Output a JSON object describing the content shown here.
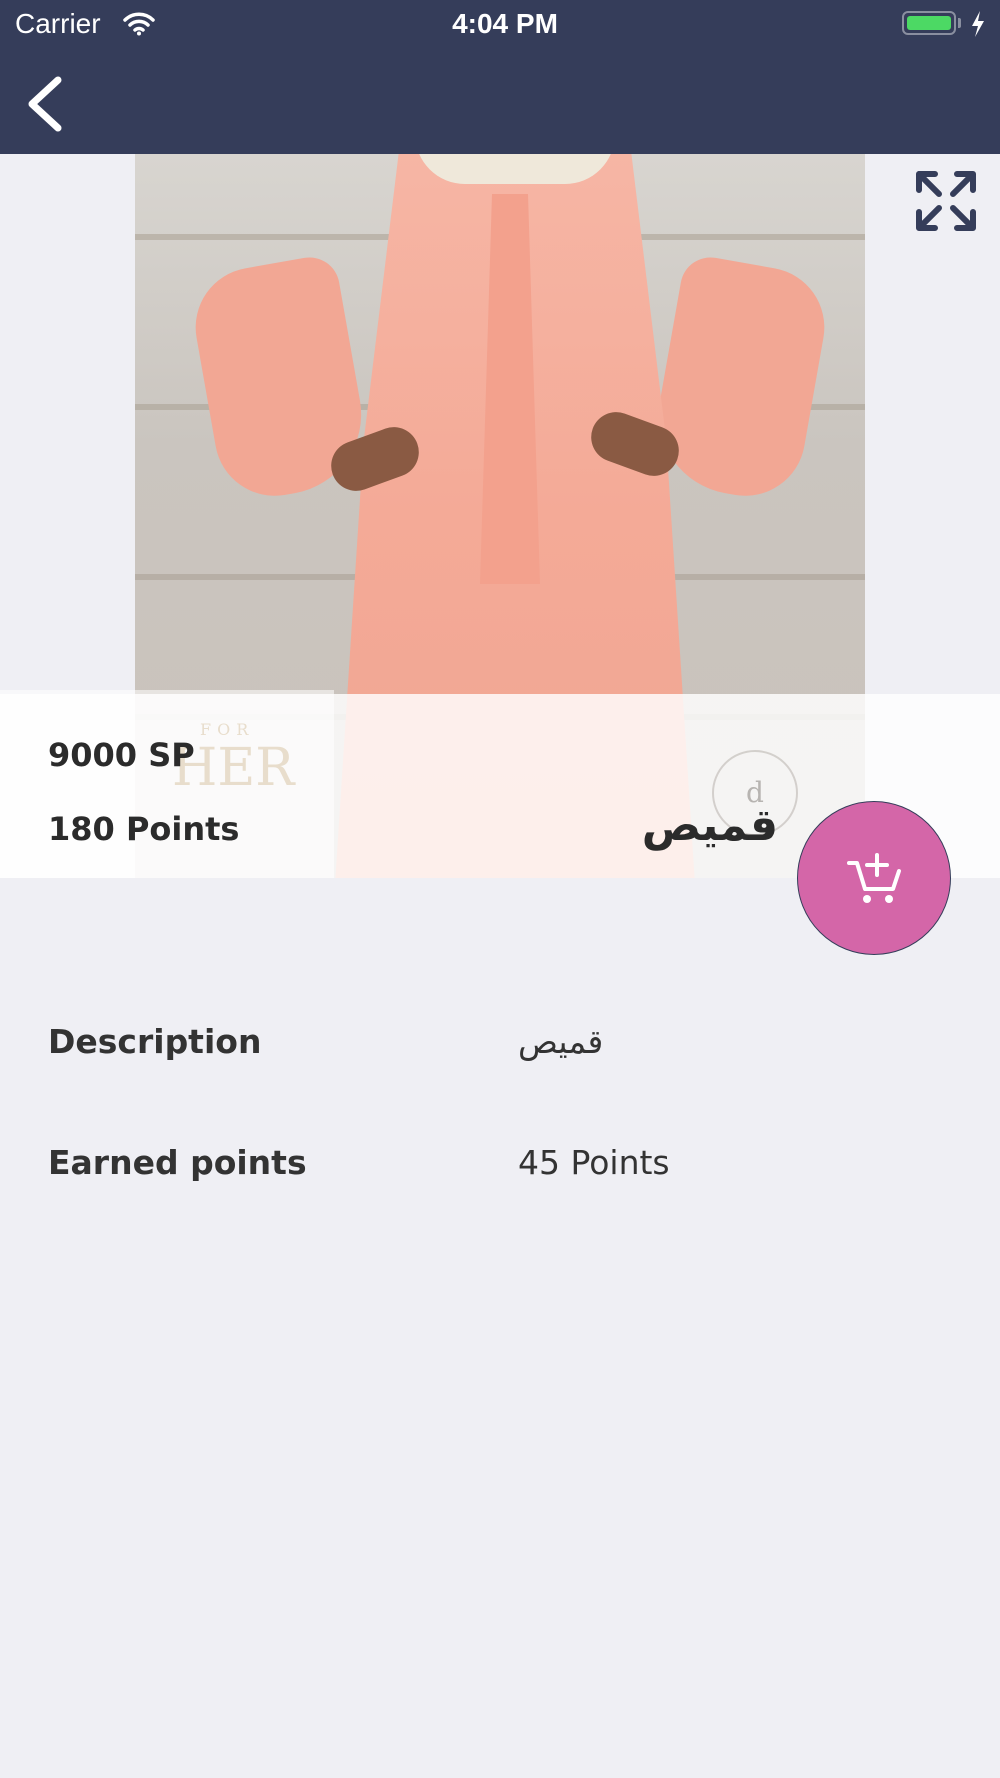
{
  "status_bar": {
    "carrier": "Carrier",
    "time": "4:04 PM"
  },
  "nav": {
    "back_icon": "chevron-left-icon"
  },
  "image": {
    "fullscreen_icon": "expand-arrows-icon",
    "logo_sub": "FOR",
    "logo_main": "HER",
    "seal_text": "d"
  },
  "product": {
    "price": "9000 SP",
    "points": "180 Points",
    "name": "قميص"
  },
  "cart_button": {
    "icon": "add-to-cart-icon",
    "color": "#d466a8"
  },
  "details": [
    {
      "label": "Description",
      "value": "قميص"
    },
    {
      "label": "Earned points",
      "value": "45 Points"
    }
  ],
  "colors": {
    "header": "#353d5a",
    "background": "#efeff4",
    "accent": "#d466a8"
  }
}
